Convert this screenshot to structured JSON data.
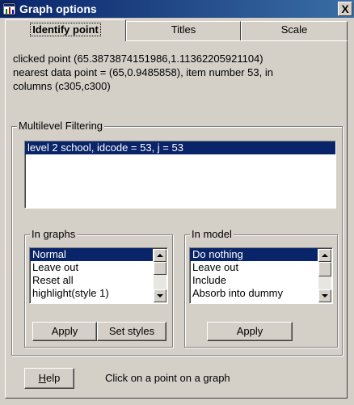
{
  "window": {
    "title": "Graph options",
    "close_glyph": "X",
    "icon": "graph-window-icon"
  },
  "tabs": [
    {
      "label": "Identify point",
      "active": true
    },
    {
      "label": "Titles",
      "active": false
    },
    {
      "label": "Scale",
      "active": false
    }
  ],
  "info": {
    "line1": "clicked point (65.3873874151986,1.11362205921104)",
    "line2": "nearest data point = (65,0.9485858), item number 53, in",
    "line3": "columns (c305,c300)"
  },
  "multilevel": {
    "label": "Multilevel Filtering",
    "items": [
      "level 2  school, idcode = 53,   j = 53"
    ]
  },
  "in_graphs": {
    "label": "In graphs",
    "items": [
      "Normal",
      "Leave out",
      "Reset all",
      "highlight(style 1)"
    ],
    "selected_index": 0,
    "apply_label": "Apply",
    "set_styles_label": "Set styles"
  },
  "in_model": {
    "label": "In model",
    "items": [
      "Do nothing",
      "Leave out",
      "Include",
      "Absorb into dummy"
    ],
    "selected_index": 0,
    "apply_label": "Apply"
  },
  "footer": {
    "help_label_prefix": "",
    "help_label_underlined": "H",
    "help_label_rest": "elp",
    "status": "Click on a point on a graph"
  },
  "colors": {
    "selection": "#0a246a",
    "face": "#d4d0c8",
    "titlebar_start": "#0a246a",
    "titlebar_end": "#3a6ea5"
  }
}
